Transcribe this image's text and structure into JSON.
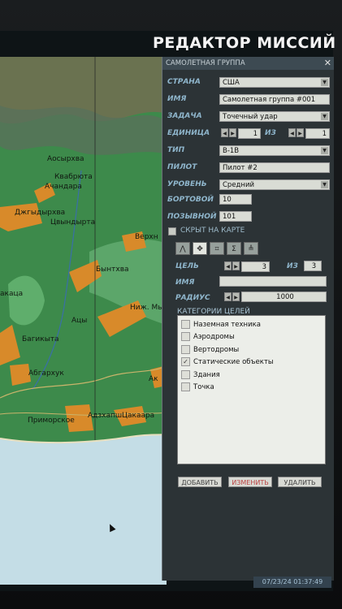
{
  "app_title": "РЕДАКТОР МИССИЙ",
  "panel": {
    "title": "САМОЛЕТНАЯ ГРУППА",
    "close_glyph": "✕",
    "country": {
      "label": "СТРАНА",
      "value": "США"
    },
    "name": {
      "label": "ИМЯ",
      "value": "Самолетная группа #001"
    },
    "task": {
      "label": "ЗАДАЧА",
      "value": "Точечный удар"
    },
    "unit": {
      "label": "ЕДИНИЦА",
      "value": "1",
      "of_label": "ИЗ",
      "total": "1"
    },
    "type": {
      "label": "ТИП",
      "value": "B-1B"
    },
    "pilot": {
      "label": "ПИЛОТ",
      "value": "Пилот #2"
    },
    "level": {
      "label": "УРОВЕНЬ",
      "value": "Средний"
    },
    "board": {
      "label": "БОРТОВОЙ",
      "value": "10"
    },
    "callsign": {
      "label": "ПОЗЫВНОЙ",
      "value": "101"
    },
    "hidden_on_map": {
      "label": "СКРЫТ НА КАРТЕ"
    },
    "toolbar_icons": [
      "route-icon",
      "target-icon",
      "waypoint-icon",
      "sigma-icon",
      "triangle-icon"
    ],
    "target": {
      "label": "ЦЕЛЬ",
      "value": "3",
      "of_label": "ИЗ",
      "total": "3"
    },
    "target_name": {
      "label": "ИМЯ",
      "value": ""
    },
    "radius": {
      "label": "РАДИУС",
      "value": "1000"
    },
    "categories_header": "КАТЕГОРИИ ЦЕЛЕЙ",
    "categories": [
      {
        "label": "Наземная техника",
        "checked": false
      },
      {
        "label": "Аэродромы",
        "checked": false
      },
      {
        "label": "Вертодромы",
        "checked": false
      },
      {
        "label": "Статические объекты",
        "checked": true
      },
      {
        "label": "Здания",
        "checked": false
      },
      {
        "label": "Точка",
        "checked": false
      }
    ],
    "buttons": {
      "add": "ДОБАВИТЬ",
      "edit": "ИЗМЕНИТЬ",
      "delete": "УДАЛИТЬ"
    }
  },
  "map_labels": [
    "Аосырхва",
    "Квабрюта",
    "Ачандара",
    "Джгыдырхва",
    "Цвындырта",
    "Верхн",
    "Бынтхва",
    "акаца",
    "Ниж. Мь",
    "Ацы",
    "Багикыта",
    "Абгархук",
    "Ак",
    "Приморское",
    "Адзхапш",
    "Цакаара"
  ],
  "status_time": "07/23/24 01:37:49",
  "colors": {
    "land": "#3d8a4b",
    "sea": "#c4dde6",
    "panel": "#2c3336",
    "label_blue": "#8fb6cc",
    "town": "#d88a2a"
  }
}
